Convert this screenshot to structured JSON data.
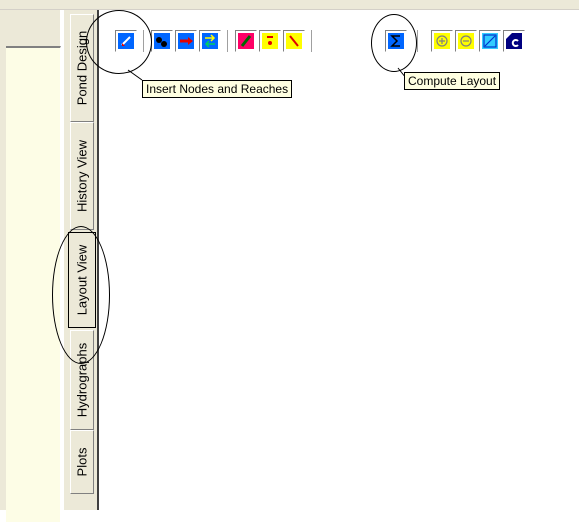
{
  "tabs": [
    {
      "label": "Pond Design"
    },
    {
      "label": "History View"
    },
    {
      "label": "Layout View"
    },
    {
      "label": "Hydrographs"
    },
    {
      "label": "Plots"
    }
  ],
  "toolbar": {
    "buttons": [
      {
        "icon": "insert-nodes-reaches-icon"
      },
      {
        "icon": "node-icon"
      },
      {
        "icon": "reach-arrow-icon"
      },
      {
        "icon": "swap-icon"
      },
      {
        "icon": "pink-tool-icon"
      },
      {
        "icon": "yellow-marker-icon"
      },
      {
        "icon": "yellow-slash-icon"
      },
      {
        "icon": "sigma-icon"
      },
      {
        "icon": "zoom-in-icon"
      },
      {
        "icon": "zoom-out-icon"
      },
      {
        "icon": "fit-icon"
      },
      {
        "icon": "c-icon"
      }
    ]
  },
  "tooltips": {
    "insert": "Insert Nodes and Reaches",
    "compute": "Compute Layout"
  },
  "colors": {
    "button_blue": "#0066ff",
    "button_pink": "#ff0066",
    "button_yellow": "#ffff00",
    "tooltip_bg": "#ffffe1"
  }
}
